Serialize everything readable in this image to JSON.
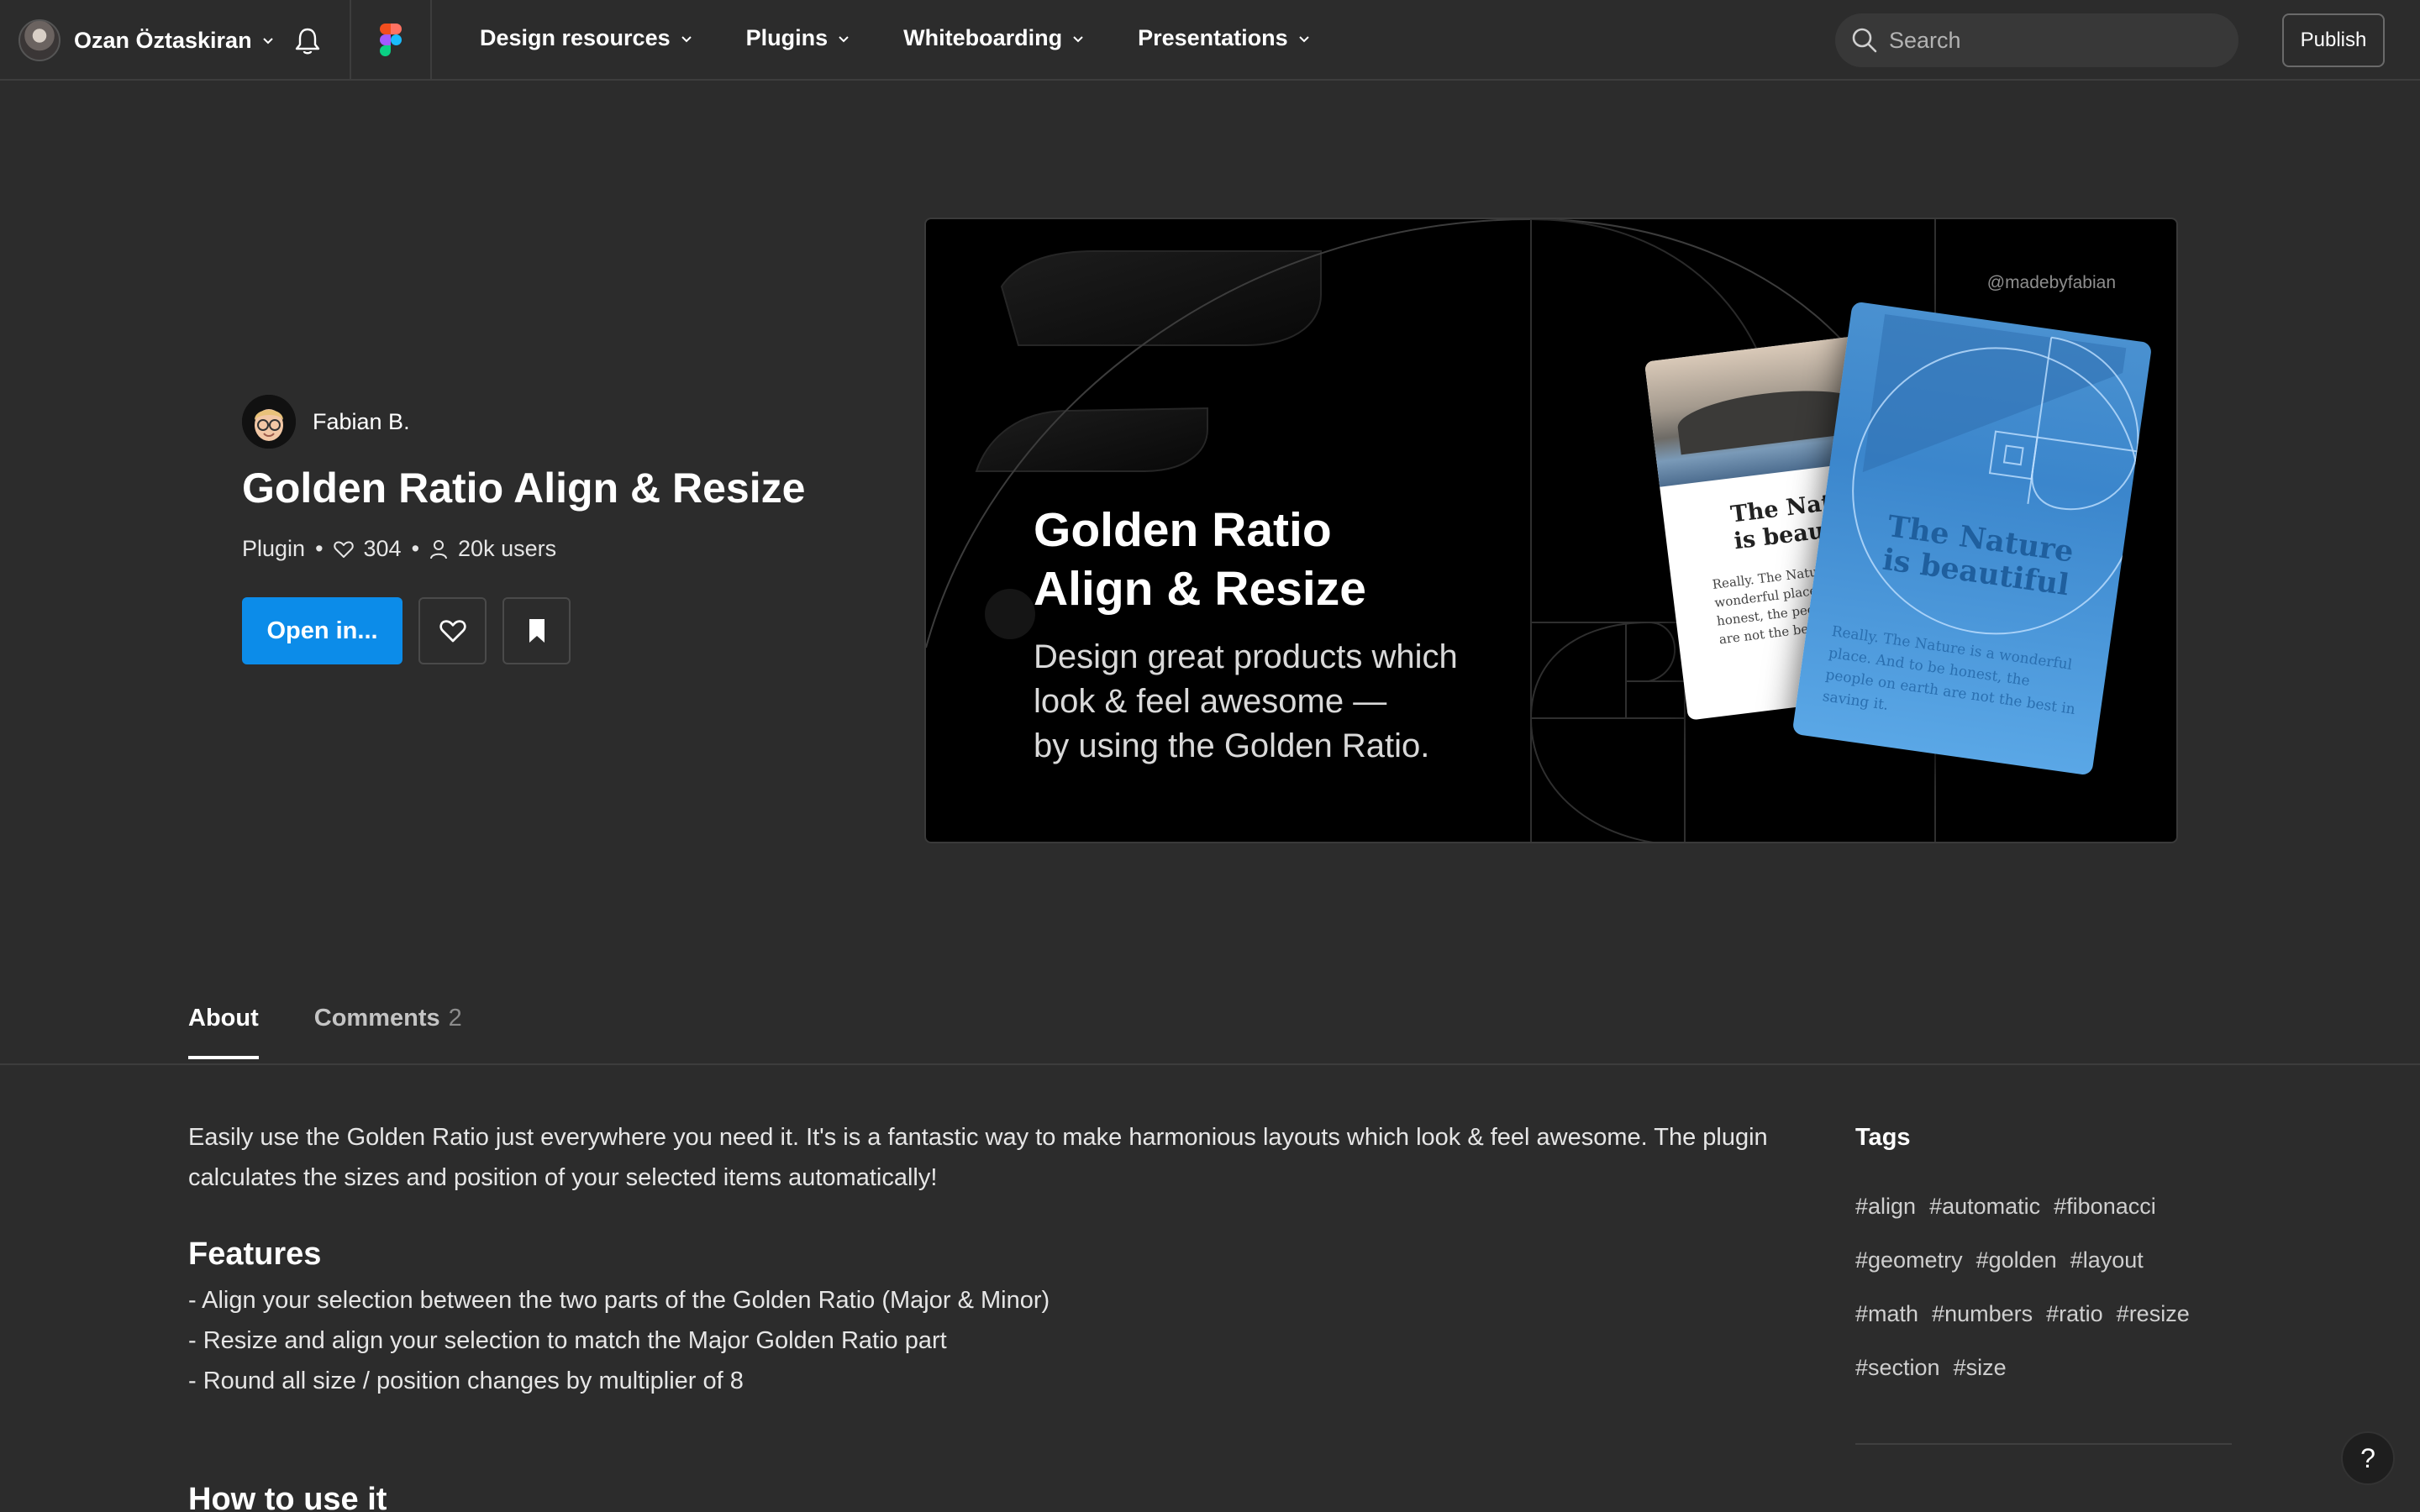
{
  "topbar": {
    "user_name": "Ozan Öztaskiran",
    "nav": [
      {
        "label": "Design resources"
      },
      {
        "label": "Plugins"
      },
      {
        "label": "Whiteboarding"
      },
      {
        "label": "Presentations"
      }
    ],
    "search_placeholder": "Search",
    "publish_label": "Publish"
  },
  "plugin": {
    "author": "Fabian B.",
    "title": "Golden Ratio Align & Resize",
    "type": "Plugin",
    "likes": "304",
    "users": "20k users",
    "open_label": "Open in..."
  },
  "cover": {
    "handle": "@madebyfabian",
    "title_line1": "Golden Ratio",
    "title_line2": "Align & Resize",
    "sub_line1": "Design great products which",
    "sub_line2": "look & feel awesome —",
    "sub_line3": "by using the Golden Ratio.",
    "card_title": "The Nature is beautiful",
    "card_body": "Really. The Nature is a wonderful place. And to be honest, the people on earth are not the best in saving it."
  },
  "tabs": [
    {
      "label": "About"
    },
    {
      "label": "Comments",
      "count": "2"
    }
  ],
  "about": {
    "description": "Easily use the Golden Ratio just everywhere you need it. It's is a fantastic way to make harmonious layouts which look & feel awesome. The plugin calculates the sizes and position of your selected items automatically!",
    "features_heading": "Features",
    "features": [
      "- Align your selection between the two parts of the Golden Ratio (Major & Minor)",
      "- Resize and align your selection to match the Major Golden Ratio part",
      "- Round all size / position changes by multiplier of 8"
    ],
    "howto_heading": "How to use it"
  },
  "tags": {
    "heading": "Tags",
    "rows": [
      [
        "#align",
        "#automatic",
        "#fibonacci"
      ],
      [
        "#geometry",
        "#golden",
        "#layout"
      ],
      [
        "#math",
        "#numbers",
        "#ratio",
        "#resize"
      ],
      [
        "#section",
        "#size"
      ]
    ]
  },
  "help_label": "?",
  "colors": {
    "background": "#2c2c2c",
    "primary_button": "#0c8ce9",
    "text": "#ffffff"
  }
}
